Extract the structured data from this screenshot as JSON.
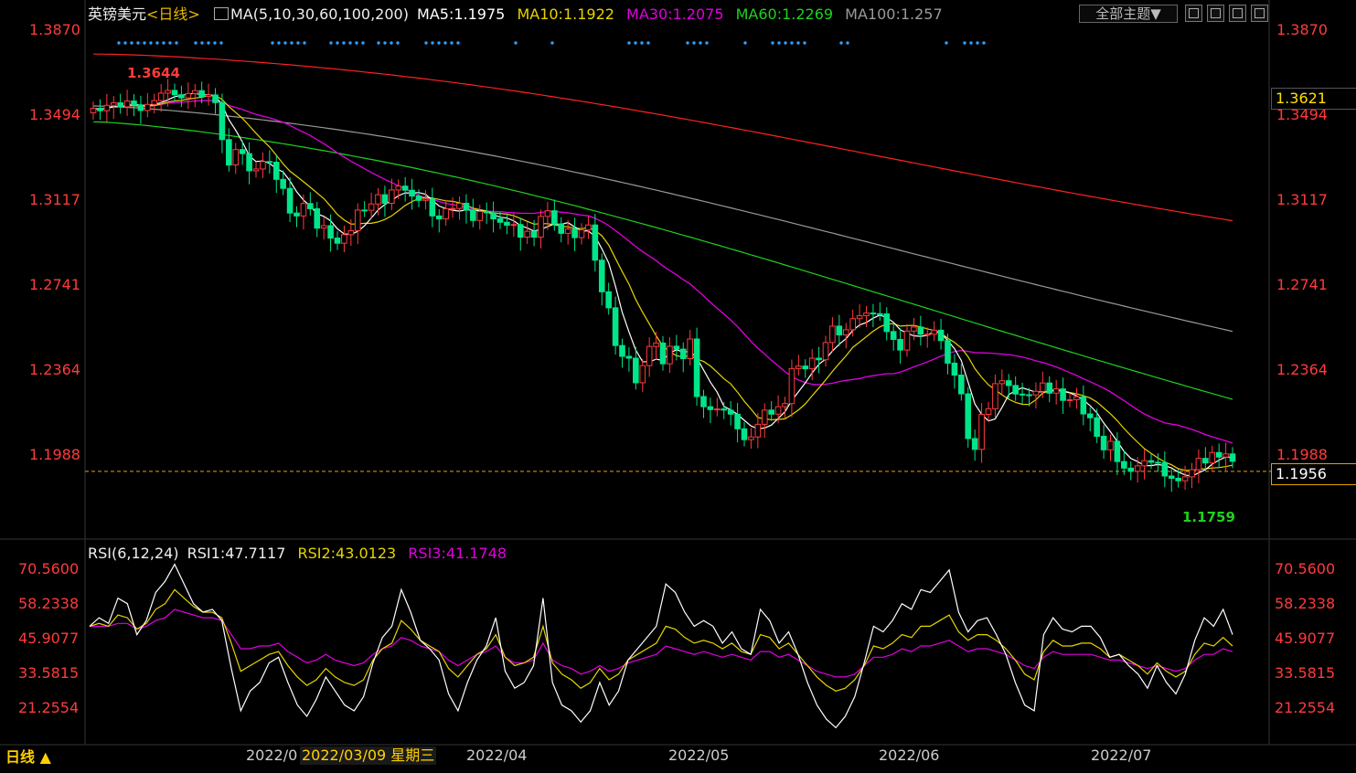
{
  "header": {
    "symbol": "英镑美元",
    "period_tag": "<日线>",
    "ma_title": "MA(5,10,30,60,100,200)",
    "ma5": "MA5:1.1975",
    "ma10": "MA10:1.1922",
    "ma30": "MA30:1.2075",
    "ma60": "MA60:1.2269",
    "ma100": "MA100:1.257",
    "theme_button": "全部主题▼"
  },
  "rsi_header": {
    "title": "RSI(6,12,24)",
    "rsi1": "RSI1:47.7117",
    "rsi2": "RSI2:43.0123",
    "rsi3": "RSI3:41.1748"
  },
  "price_labels": {
    "current": "1.3621",
    "last": "1.1956",
    "high_mark": "1.3644",
    "low_mark": "1.1759"
  },
  "footer": {
    "period_button": "日线 ▲",
    "crosshair_date": "2022/03/09 星期三",
    "month_labels": [
      "2022/0",
      "2022/04",
      "2022/05",
      "2022/06",
      "2022/07"
    ]
  },
  "colors": {
    "up": "#ff3b3b",
    "down": "#00e58a",
    "ma5": "#ffffff",
    "ma10": "#e6d400",
    "ma30": "#e000e0",
    "ma60": "#1fd11f",
    "ma100": "#9a9a9a",
    "ma200": "#ff2020",
    "rsi1": "#ffffff",
    "rsi2": "#e6d400",
    "rsi3": "#e000e0",
    "axis_text": "#ff3b3b"
  },
  "chart_data": [
    {
      "type": "candlestick",
      "title": "英镑美元 日线",
      "y_ticks": [
        "1.3870",
        "1.3494",
        "1.3117",
        "1.2741",
        "1.2364",
        "1.1988"
      ],
      "ylim": [
        1.1759,
        1.387
      ],
      "x_labels": [
        "2022/03",
        "2022/04",
        "2022/05",
        "2022/06",
        "2022/07"
      ],
      "high": 1.3644,
      "low": 1.1759,
      "last": 1.1956,
      "closes": [
        1.352,
        1.3509,
        1.3533,
        1.3544,
        1.3526,
        1.3552,
        1.3535,
        1.351,
        1.3537,
        1.3554,
        1.3587,
        1.3599,
        1.358,
        1.3566,
        1.3585,
        1.3598,
        1.3572,
        1.3579,
        1.3545,
        1.3381,
        1.3269,
        1.3337,
        1.3319,
        1.3243,
        1.3251,
        1.3284,
        1.3281,
        1.3205,
        1.3165,
        1.3056,
        1.3043,
        1.3098,
        1.3075,
        1.2989,
        1.3,
        1.2945,
        1.2922,
        1.296,
        1.2978,
        1.3069,
        1.3068,
        1.3096,
        1.3137,
        1.3099,
        1.3158,
        1.3175,
        1.3157,
        1.3131,
        1.3112,
        1.3118,
        1.3043,
        1.303,
        1.3075,
        1.3076,
        1.3099,
        1.3069,
        1.3023,
        1.3063,
        1.3057,
        1.303,
        1.3015,
        1.3002,
        1.3005,
        1.2949,
        1.2975,
        1.2949,
        1.3041,
        1.3066,
        1.3007,
        1.2966,
        1.2985,
        1.2947,
        1.2981,
        1.3003,
        1.2847,
        1.2707,
        1.2636,
        1.2469,
        1.2421,
        1.2413,
        1.2304,
        1.238,
        1.2465,
        1.248,
        1.2388,
        1.2466,
        1.2453,
        1.2411,
        1.2498,
        1.2243,
        1.2198,
        1.2185,
        1.2188,
        1.2183,
        1.2165,
        1.21,
        1.2052,
        1.2064,
        1.212,
        1.2183,
        1.2165,
        1.2198,
        1.2212,
        1.2367,
        1.2378,
        1.2366,
        1.2413,
        1.2406,
        1.2482,
        1.2555,
        1.2516,
        1.2539,
        1.2588,
        1.2601,
        1.2613,
        1.261,
        1.2609,
        1.2531,
        1.2496,
        1.2449,
        1.2533,
        1.2551,
        1.2519,
        1.2519,
        1.2537,
        1.2491,
        1.2391,
        1.2338,
        1.2255,
        1.2057,
        1.2009,
        1.2164,
        1.2189,
        1.23,
        1.2313,
        1.2292,
        1.2254,
        1.2251,
        1.225,
        1.2266,
        1.2303,
        1.2258,
        1.2277,
        1.2226,
        1.2229,
        1.2242,
        1.2166,
        1.2149,
        1.2067,
        1.2007,
        1.2045,
        1.1955,
        1.1926,
        1.1912,
        1.1936,
        1.1959,
        1.1952,
        1.195,
        1.1891,
        1.1881,
        1.187,
        1.1887,
        1.1919,
        1.1969,
        1.1949,
        1.1995,
        1.1975,
        1.1989,
        1.1956
      ],
      "series": [
        {
          "name": "MA5",
          "start": 1.353,
          "end": 1.1975
        },
        {
          "name": "MA10",
          "start": 1.354,
          "end": 1.1922
        },
        {
          "name": "MA30",
          "start": 1.354,
          "end": 1.2075
        },
        {
          "name": "MA60",
          "start": 1.346,
          "end": 1.2269
        },
        {
          "name": "MA100",
          "start": 1.353,
          "end": 1.257
        },
        {
          "name": "MA200",
          "start": 1.376,
          "end": 1.306
        }
      ]
    },
    {
      "type": "line",
      "title": "RSI(6,12,24)",
      "y_ticks": [
        "70.5600",
        "58.2338",
        "45.9077",
        "33.5815",
        "21.2554"
      ],
      "ylim": [
        14.0,
        72.0
      ],
      "series": [
        {
          "name": "RSI1",
          "last": 47.7117,
          "values": [
            50,
            53,
            51,
            60,
            58,
            47,
            52,
            62,
            66,
            72,
            65,
            58,
            55,
            56,
            52,
            35,
            20,
            27,
            30,
            37,
            39,
            30,
            22,
            18,
            24,
            32,
            27,
            22,
            20,
            25,
            37,
            46,
            50,
            63,
            55,
            45,
            42,
            38,
            26,
            20,
            30,
            38,
            43,
            53,
            34,
            28,
            30,
            36,
            60,
            30,
            22,
            20,
            16,
            20,
            30,
            22,
            27,
            38,
            42,
            46,
            50,
            65,
            62,
            55,
            50,
            52,
            50,
            44,
            48,
            42,
            40,
            56,
            52,
            44,
            48,
            40,
            30,
            22,
            17,
            14,
            18,
            25,
            37,
            50,
            48,
            52,
            58,
            56,
            63,
            62,
            66,
            70,
            55,
            48,
            52,
            53,
            47,
            40,
            30,
            22,
            20,
            47,
            53,
            49,
            48,
            50,
            50,
            46,
            39,
            40,
            36,
            33,
            28,
            36,
            30,
            26,
            33,
            45,
            53,
            50,
            56,
            47
          ]
        },
        {
          "name": "RSI2",
          "last": 43.0123,
          "values": [
            50,
            51,
            50,
            54,
            53,
            49,
            51,
            56,
            58,
            63,
            60,
            57,
            55,
            55,
            53,
            44,
            34,
            36,
            38,
            40,
            41,
            36,
            32,
            29,
            31,
            35,
            32,
            30,
            29,
            31,
            38,
            42,
            44,
            52,
            49,
            45,
            43,
            41,
            35,
            32,
            36,
            40,
            42,
            47,
            39,
            36,
            37,
            39,
            50,
            37,
            33,
            31,
            28,
            30,
            35,
            31,
            33,
            38,
            40,
            42,
            44,
            50,
            49,
            46,
            44,
            45,
            44,
            42,
            44,
            41,
            40,
            47,
            46,
            42,
            44,
            40,
            36,
            32,
            29,
            27,
            28,
            31,
            36,
            43,
            42,
            44,
            47,
            46,
            50,
            50,
            52,
            54,
            48,
            45,
            47,
            47,
            45,
            42,
            38,
            33,
            31,
            41,
            45,
            43,
            43,
            44,
            44,
            42,
            39,
            40,
            38,
            36,
            33,
            37,
            34,
            32,
            34,
            40,
            44,
            43,
            46,
            43
          ]
        },
        {
          "name": "RSI3",
          "last": 41.1748,
          "values": [
            50,
            50,
            50,
            51,
            51,
            49,
            50,
            52,
            53,
            56,
            55,
            54,
            53,
            53,
            52,
            47,
            42,
            42,
            43,
            43,
            44,
            41,
            39,
            37,
            38,
            40,
            38,
            37,
            36,
            37,
            40,
            42,
            43,
            46,
            45,
            43,
            42,
            41,
            38,
            36,
            38,
            40,
            41,
            43,
            39,
            37,
            37,
            38,
            44,
            38,
            36,
            35,
            33,
            34,
            36,
            34,
            35,
            37,
            38,
            39,
            40,
            43,
            42,
            41,
            40,
            41,
            40,
            39,
            40,
            39,
            38,
            41,
            41,
            39,
            40,
            38,
            36,
            34,
            33,
            32,
            32,
            33,
            36,
            39,
            39,
            40,
            42,
            41,
            43,
            43,
            44,
            45,
            43,
            41,
            42,
            42,
            41,
            40,
            38,
            36,
            35,
            39,
            41,
            40,
            40,
            40,
            40,
            39,
            38,
            38,
            37,
            36,
            35,
            36,
            35,
            34,
            35,
            38,
            40,
            40,
            42,
            41
          ]
        }
      ]
    }
  ]
}
